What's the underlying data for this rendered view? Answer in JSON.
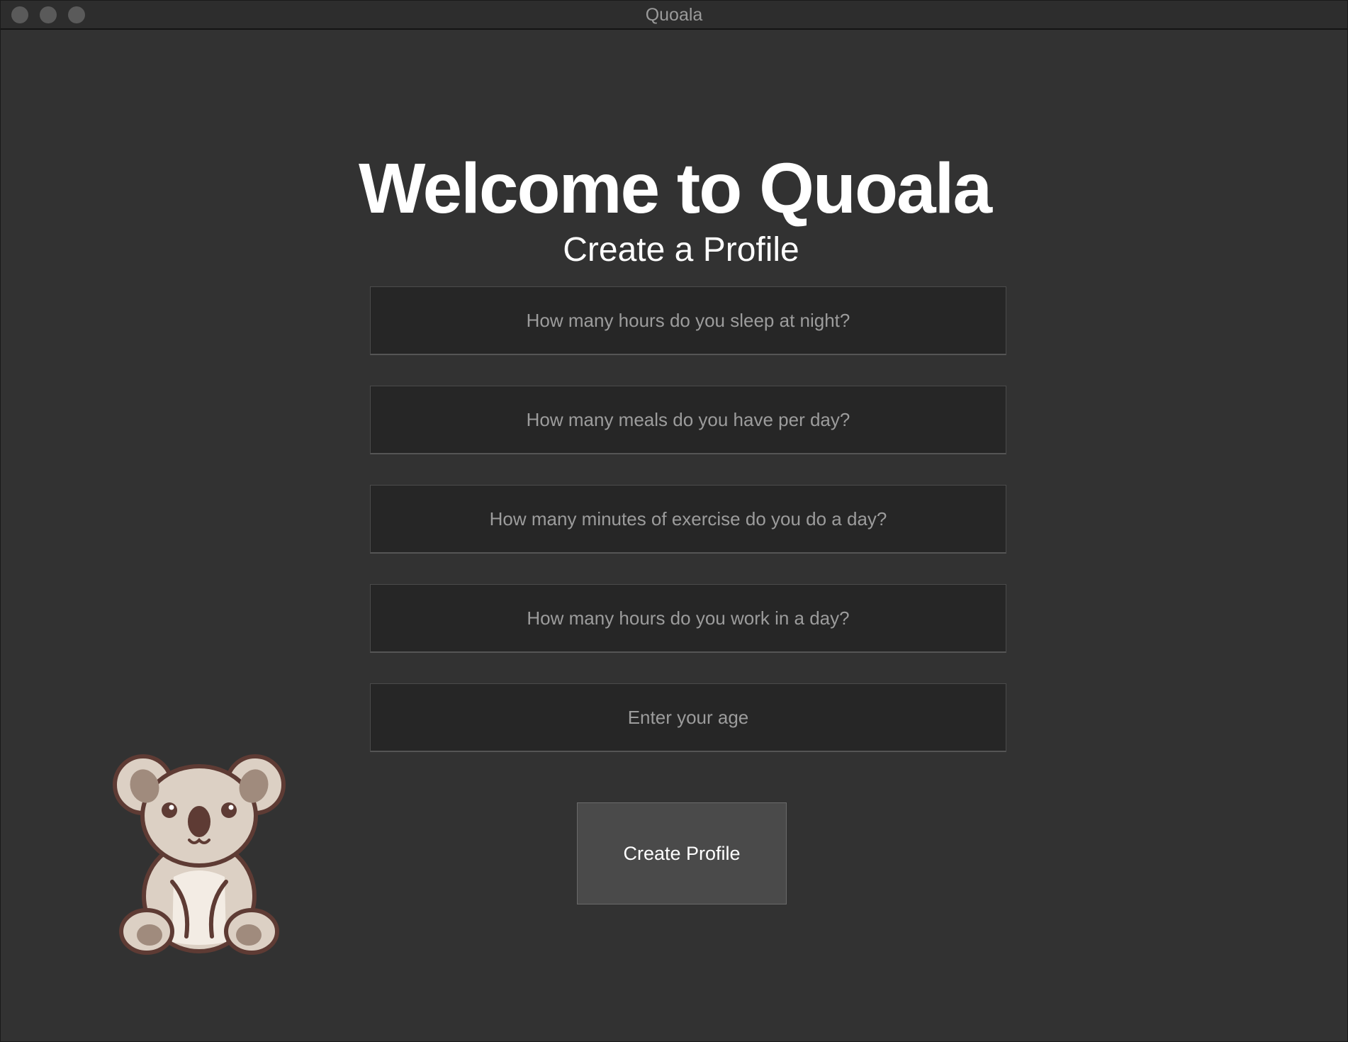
{
  "window": {
    "title": "Quoala"
  },
  "main": {
    "heading": "Welcome to Quoala",
    "subheading": "Create a Profile",
    "fields": [
      {
        "placeholder": "How many hours do you sleep at night?",
        "value": ""
      },
      {
        "placeholder": "How many meals do you have per day?",
        "value": ""
      },
      {
        "placeholder": "How many minutes of exercise do you do a day?",
        "value": ""
      },
      {
        "placeholder": "How many hours do you work in a day?",
        "value": ""
      },
      {
        "placeholder": "Enter your age",
        "value": ""
      }
    ],
    "submit_label": "Create Profile"
  },
  "mascot": {
    "icon": "koala-icon"
  },
  "colors": {
    "window_bg": "#323232",
    "field_bg": "#262626",
    "button_bg": "#4a4a4a",
    "text_primary": "#ffffff",
    "text_placeholder": "#9c9c9c"
  }
}
